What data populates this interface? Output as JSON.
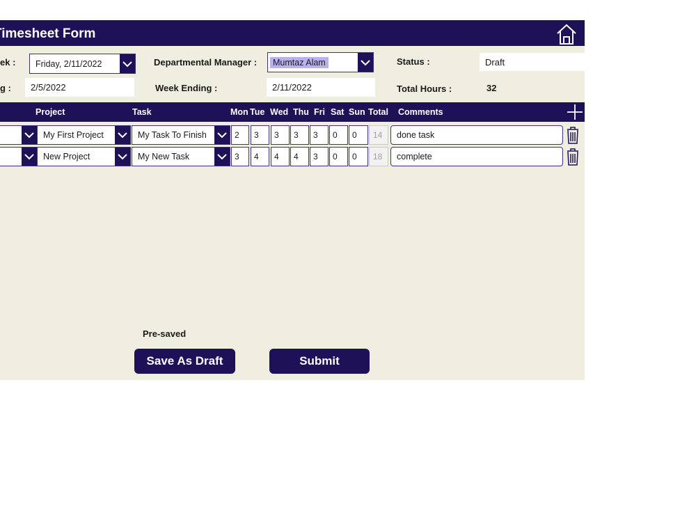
{
  "header": {
    "title": "Timesheet Form",
    "home_icon": "home-icon"
  },
  "form": {
    "week_label": "ek :",
    "week_value": "Friday, 2/11/2022",
    "manager_label": "Departmental Manager :",
    "manager_value": "Mumtaz Alam",
    "status_label": "Status :",
    "status_value": "Draft",
    "starting_label": "g :",
    "starting_value": "2/5/2022",
    "week_ending_label": "Week Ending :",
    "week_ending_value": "2/11/2022",
    "total_hours_label": "Total Hours :",
    "total_hours_value": "32"
  },
  "grid": {
    "columns": {
      "project": "Project",
      "task": "Task",
      "mon": "Mon",
      "tue": "Tue",
      "wed": "Wed",
      "thu": "Thu",
      "fri": "Fri",
      "sat": "Sat",
      "sun": "Sun",
      "total": "Total",
      "comments": "Comments"
    },
    "rows": [
      {
        "project": "My First Project",
        "task": "My Task To Finish",
        "mon": "2",
        "tue": "3",
        "wed": "3",
        "thu": "3",
        "fri": "3",
        "sat": "0",
        "sun": "0",
        "total": "14",
        "comment": "done task"
      },
      {
        "project": "New Project",
        "task": "My New Task",
        "mon": "3",
        "tue": "4",
        "wed": "4",
        "thu": "4",
        "fri": "3",
        "sat": "0",
        "sun": "0",
        "total": "18",
        "comment": "complete"
      }
    ]
  },
  "footer": {
    "status_text": "Pre-saved",
    "save_draft_label": "Save As Draft",
    "submit_label": "Submit"
  },
  "colors": {
    "header_bg": "#1e1158",
    "form_bg": "#f0eee0",
    "highlight": "#b9b0ee"
  }
}
